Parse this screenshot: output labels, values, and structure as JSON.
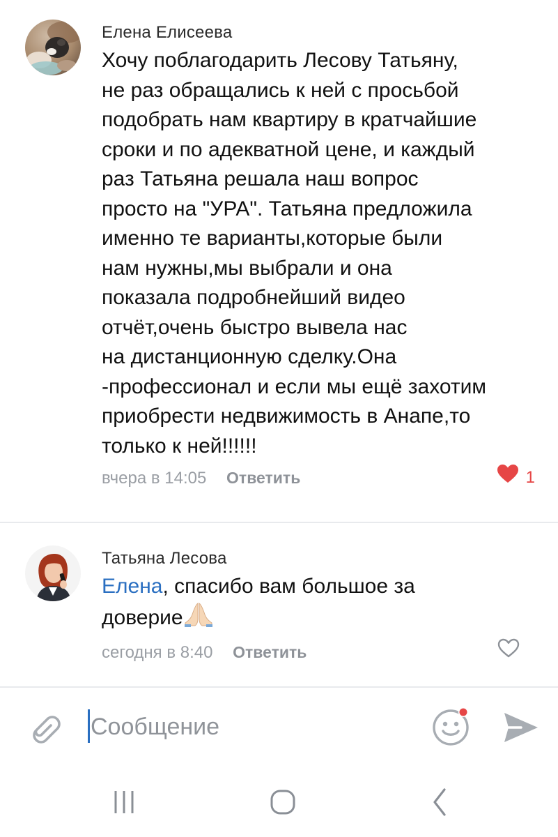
{
  "comments": [
    {
      "author": "Елена Елисеева",
      "lines": [
        "Хочу поблагодарить Лесову Татьяну,",
        "не раз обращались к ней с просьбой",
        "подобрать нам квартиру в кратчайшие",
        "сроки и по адекватной цене, и каждый",
        "раз Татьяна решала наш вопрос",
        "просто на \"УРА\". Татьяна предложила",
        "именно те варианты,которые были",
        "нам нужны,мы выбрали и она",
        "показала подробнейший видео",
        "отчёт,очень быстро вывела нас",
        "на дистанционную сделку.Она",
        "-профессионал и если мы ещё захотим",
        "приобрести недвижимость в Анапе,то",
        "только к ней!!!!!!"
      ],
      "time": "вчера в 14:05",
      "reply_label": "Ответить",
      "like_count": "1",
      "liked": true
    },
    {
      "author": "Татьяна Лесова",
      "mention": "Елена",
      "line1_rest": ", спасибо вам большое за",
      "line2": "доверие",
      "emoji": "folded-hands",
      "time": "сегодня в 8:40",
      "reply_label": "Ответить",
      "liked": false
    }
  ],
  "composer": {
    "placeholder": "Сообщение",
    "value": ""
  },
  "icons": {
    "attach": "paperclip-icon",
    "emoji": "smiley-icon",
    "send": "send-arrow-icon",
    "like_filled": "heart-filled-icon",
    "like_outline": "heart-outline-icon",
    "nav_recents": "recents-icon",
    "nav_home": "home-icon",
    "nav_back": "back-icon"
  },
  "colors": {
    "accent": "#2a6fc1",
    "like": "#e64646",
    "meta": "#9a9ea4",
    "icon_gray": "#a8adb3",
    "notification_dot": "#e64646"
  }
}
